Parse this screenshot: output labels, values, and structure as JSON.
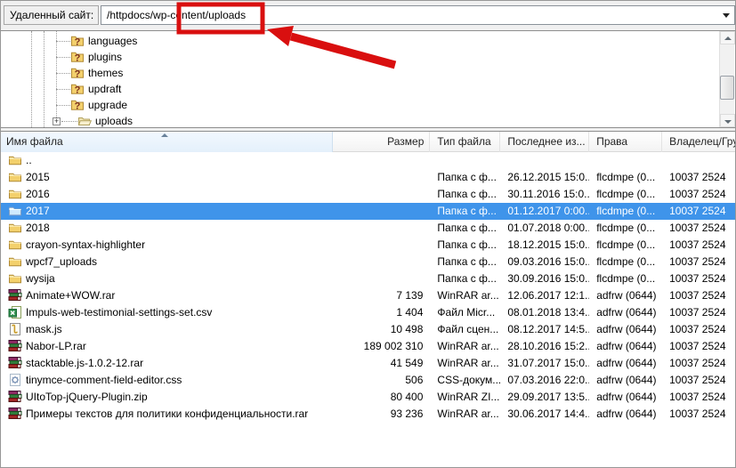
{
  "address_bar": {
    "label": "Удаленный сайт:",
    "value": "/httpdocs/wp-content/uploads"
  },
  "tree": {
    "items": [
      {
        "label": "languages",
        "icon": "question-folder",
        "expandable": false
      },
      {
        "label": "plugins",
        "icon": "question-folder",
        "expandable": false
      },
      {
        "label": "themes",
        "icon": "question-folder",
        "expandable": false
      },
      {
        "label": "updraft",
        "icon": "question-folder",
        "expandable": false
      },
      {
        "label": "upgrade",
        "icon": "question-folder",
        "expandable": false
      },
      {
        "label": "uploads",
        "icon": "open-folder",
        "expandable": true,
        "expander_glyph": "+"
      }
    ]
  },
  "file_list": {
    "columns": [
      "Имя файла",
      "Размер",
      "Тип файла",
      "Последнее из...",
      "Права",
      "Владелец/Гру"
    ],
    "sorted_column": "Имя файла",
    "rows": [
      {
        "name": "..",
        "icon": "folder",
        "size": "",
        "type": "",
        "modified": "",
        "perms": "",
        "owner": "",
        "selected": false
      },
      {
        "name": "2015",
        "icon": "folder",
        "size": "",
        "type": "Папка с ф...",
        "modified": "26.12.2015 15:0...",
        "perms": "flcdmpe (0...",
        "owner": "10037 2524",
        "selected": false
      },
      {
        "name": "2016",
        "icon": "folder",
        "size": "",
        "type": "Папка с ф...",
        "modified": "30.11.2016 15:0...",
        "perms": "flcdmpe (0...",
        "owner": "10037 2524",
        "selected": false
      },
      {
        "name": "2017",
        "icon": "folder",
        "size": "",
        "type": "Папка с ф...",
        "modified": "01.12.2017 0:00...",
        "perms": "flcdmpe (0...",
        "owner": "10037 2524",
        "selected": true
      },
      {
        "name": "2018",
        "icon": "folder",
        "size": "",
        "type": "Папка с ф...",
        "modified": "01.07.2018 0:00...",
        "perms": "flcdmpe (0...",
        "owner": "10037 2524",
        "selected": false
      },
      {
        "name": "crayon-syntax-highlighter",
        "icon": "folder",
        "size": "",
        "type": "Папка с ф...",
        "modified": "18.12.2015 15:0...",
        "perms": "flcdmpe (0...",
        "owner": "10037 2524",
        "selected": false
      },
      {
        "name": "wpcf7_uploads",
        "icon": "folder",
        "size": "",
        "type": "Папка с ф...",
        "modified": "09.03.2016 15:0...",
        "perms": "flcdmpe (0...",
        "owner": "10037 2524",
        "selected": false
      },
      {
        "name": "wysija",
        "icon": "folder",
        "size": "",
        "type": "Папка с ф...",
        "modified": "30.09.2016 15:0...",
        "perms": "flcdmpe (0...",
        "owner": "10037 2524",
        "selected": false
      },
      {
        "name": "Animate+WOW.rar",
        "icon": "winrar",
        "size": "7 139",
        "type": "WinRAR ar...",
        "modified": "12.06.2017 12:1...",
        "perms": "adfrw (0644)",
        "owner": "10037 2524",
        "selected": false
      },
      {
        "name": "Impuls-web-testimonial-settings-set.csv",
        "icon": "csv",
        "size": "1 404",
        "type": "Файл Micr...",
        "modified": "08.01.2018 13:4...",
        "perms": "adfrw (0644)",
        "owner": "10037 2524",
        "selected": false
      },
      {
        "name": "mask.js",
        "icon": "js",
        "size": "10 498",
        "type": "Файл сцен...",
        "modified": "08.12.2017 14:5...",
        "perms": "adfrw (0644)",
        "owner": "10037 2524",
        "selected": false
      },
      {
        "name": "Nabor-LP.rar",
        "icon": "winrar",
        "size": "189 002 310",
        "type": "WinRAR ar...",
        "modified": "28.10.2016 15:2...",
        "perms": "adfrw (0644)",
        "owner": "10037 2524",
        "selected": false
      },
      {
        "name": "stacktable.js-1.0.2-12.rar",
        "icon": "winrar",
        "size": "41 549",
        "type": "WinRAR ar...",
        "modified": "31.07.2017 15:0...",
        "perms": "adfrw (0644)",
        "owner": "10037 2524",
        "selected": false
      },
      {
        "name": "tinymce-comment-field-editor.css",
        "icon": "css",
        "size": "506",
        "type": "CSS-докум...",
        "modified": "07.03.2016 22:0...",
        "perms": "adfrw (0644)",
        "owner": "10037 2524",
        "selected": false
      },
      {
        "name": "UItoTop-jQuery-Plugin.zip",
        "icon": "winrar",
        "size": "80 400",
        "type": "WinRAR ZI...",
        "modified": "29.09.2017 13:5...",
        "perms": "adfrw (0644)",
        "owner": "10037 2524",
        "selected": false
      },
      {
        "name": "Примеры текстов для политики конфиденциальности.rar",
        "icon": "winrar",
        "size": "93 236",
        "type": "WinRAR ar...",
        "modified": "30.06.2017 14:4...",
        "perms": "adfrw (0644)",
        "owner": "10037 2524",
        "selected": false
      }
    ]
  },
  "annotation": {
    "shape": "highlight-box-with-arrow",
    "color": "#d90f0f"
  },
  "colors": {
    "selection": "#3f94ea",
    "sorted_header_bg": "#e4f0fb",
    "panel_bg": "#ffffff",
    "chrome_bg": "#f0f0f0"
  }
}
